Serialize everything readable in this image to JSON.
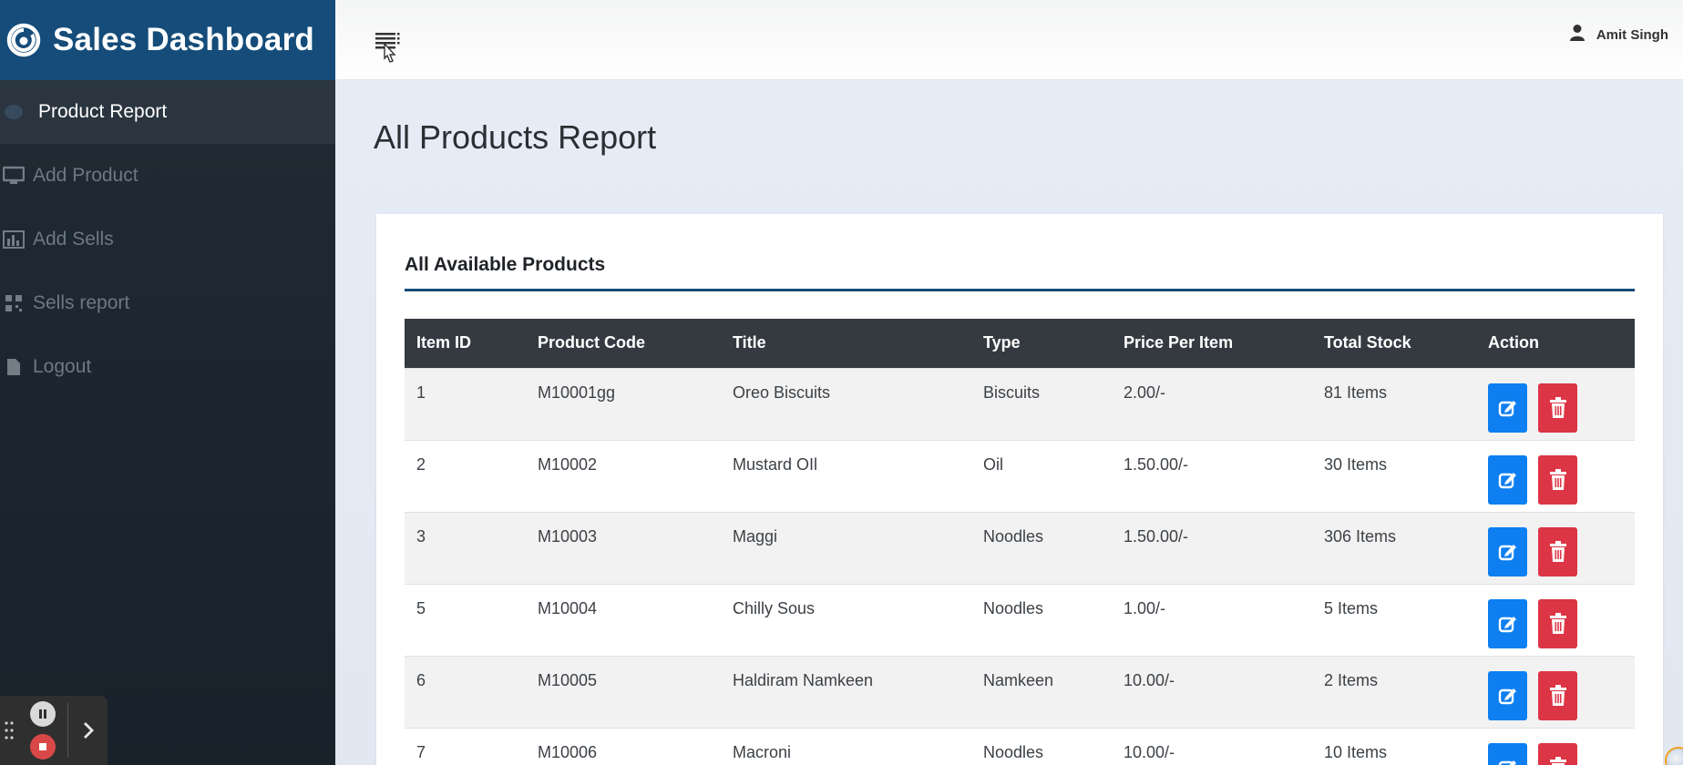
{
  "sidebar": {
    "brand": {
      "title": "Sales Dashboard",
      "icon": "power-swirl-icon"
    },
    "items": [
      {
        "label": "Product Report",
        "icon": "palette-icon",
        "active": true
      },
      {
        "label": "Add Product",
        "icon": "monitor-icon",
        "active": false
      },
      {
        "label": "Add Sells",
        "icon": "bar-chart-icon",
        "active": false
      },
      {
        "label": "Sells report",
        "icon": "qrcode-icon",
        "active": false
      },
      {
        "label": "Logout",
        "icon": "file-icon",
        "active": false
      }
    ]
  },
  "topbar": {
    "menu_icon": "hamburger-icon",
    "user": {
      "name": "Amit Singh",
      "icon": "user-icon"
    }
  },
  "main": {
    "page_title": "All Products Report",
    "card": {
      "title": "All Available Products",
      "table": {
        "headers": [
          "Item ID",
          "Product Code",
          "Title",
          "Type",
          "Price Per Item",
          "Total Stock",
          "Action"
        ],
        "rows": [
          [
            "1",
            "M10001gg",
            "Oreo Biscuits",
            "Biscuits",
            "2.00/-",
            "81 Items"
          ],
          [
            "2",
            "M10002",
            "Mustard OIl",
            "Oil",
            "1.50.00/-",
            "30 Items"
          ],
          [
            "3",
            "M10003",
            "Maggi",
            "Noodles",
            "1.50.00/-",
            "306 Items"
          ],
          [
            "5",
            "M10004",
            "Chilly Sous",
            "Noodles",
            "1.00/-",
            "5 Items"
          ],
          [
            "6",
            "M10005",
            "Haldiram Namkeen",
            "Namkeen",
            "10.00/-",
            "2 Items"
          ],
          [
            "7",
            "M10006",
            "Macroni",
            "Noodles",
            "10.00/-",
            "10 Items"
          ]
        ]
      }
    }
  },
  "colors": {
    "brand_bar": "#154c79",
    "sidebar_bg": "#1c2530",
    "table_header": "#343a40",
    "edit": "#0d7ff0",
    "delete": "#dc3545"
  }
}
